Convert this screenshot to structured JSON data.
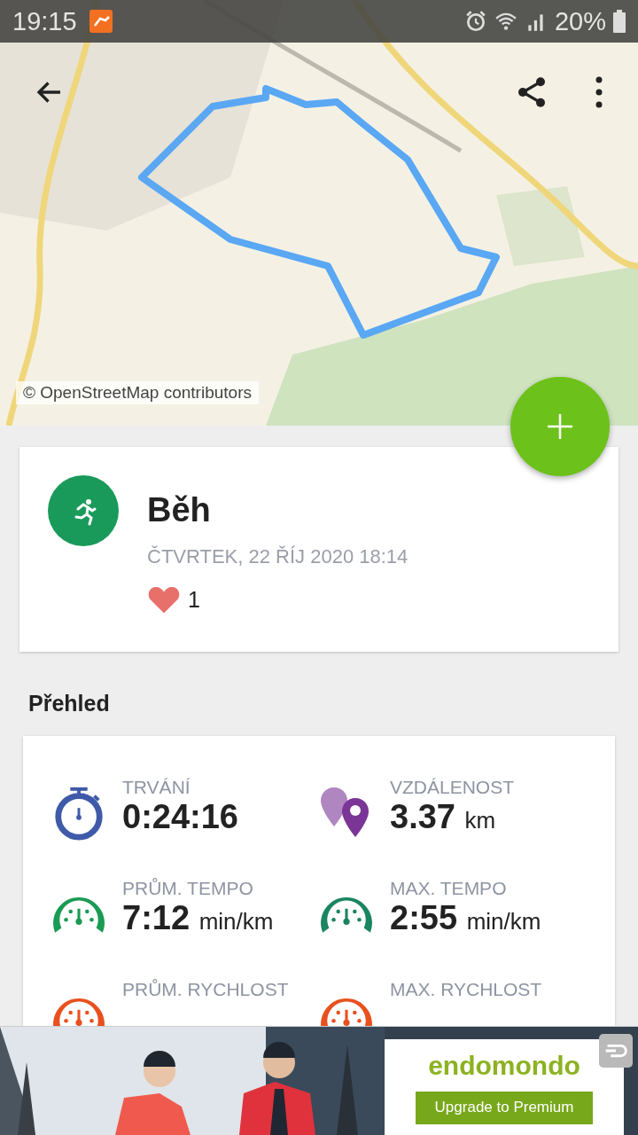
{
  "status_bar": {
    "time": "19:15",
    "battery": "20%"
  },
  "map": {
    "attribution": "© OpenStreetMap contributors"
  },
  "activity": {
    "title": "Běh",
    "date": "ČTVRTEK, 22 ŘÍJ 2020 18:14",
    "likes": "1"
  },
  "section_title": "Přehled",
  "stats": [
    {
      "kind": "stopwatch",
      "color": "#3f5aa8",
      "label": "TRVÁNÍ",
      "value": "0:24:16"
    },
    {
      "kind": "pins",
      "color": "#7b3596",
      "label": "VZDÁLENOST",
      "value": "3.37",
      "unit": "km"
    },
    {
      "kind": "gauge",
      "color": "#1a9a54",
      "label": "PRŮM. TEMPO",
      "value": "7:12",
      "unit": "min/km"
    },
    {
      "kind": "gauge",
      "color": "#1a8560",
      "label": "MAX. TEMPO",
      "value": "2:55",
      "unit": "min/km"
    },
    {
      "kind": "gauge",
      "color": "#e8501e",
      "label": "PRŮM. RYCHLOST"
    },
    {
      "kind": "gauge",
      "color": "#e8501e",
      "label": "MAX. RYCHLOST"
    }
  ],
  "ad": {
    "brand": "endomondo",
    "button": "Upgrade to Premium"
  }
}
